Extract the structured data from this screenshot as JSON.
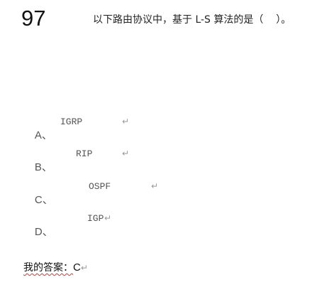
{
  "question": {
    "number": "97",
    "text": "以下路由协议中，基于 L-S 算法的是（    ）。"
  },
  "options": [
    {
      "letter": "A、",
      "text": "IGRP"
    },
    {
      "letter": "B、",
      "text": "RIP"
    },
    {
      "letter": "C、",
      "text": "OSPF"
    },
    {
      "letter": "D、",
      "text": "IGP"
    }
  ],
  "return_mark": "↵",
  "answer": {
    "label": "我的答案：",
    "value": "C"
  }
}
